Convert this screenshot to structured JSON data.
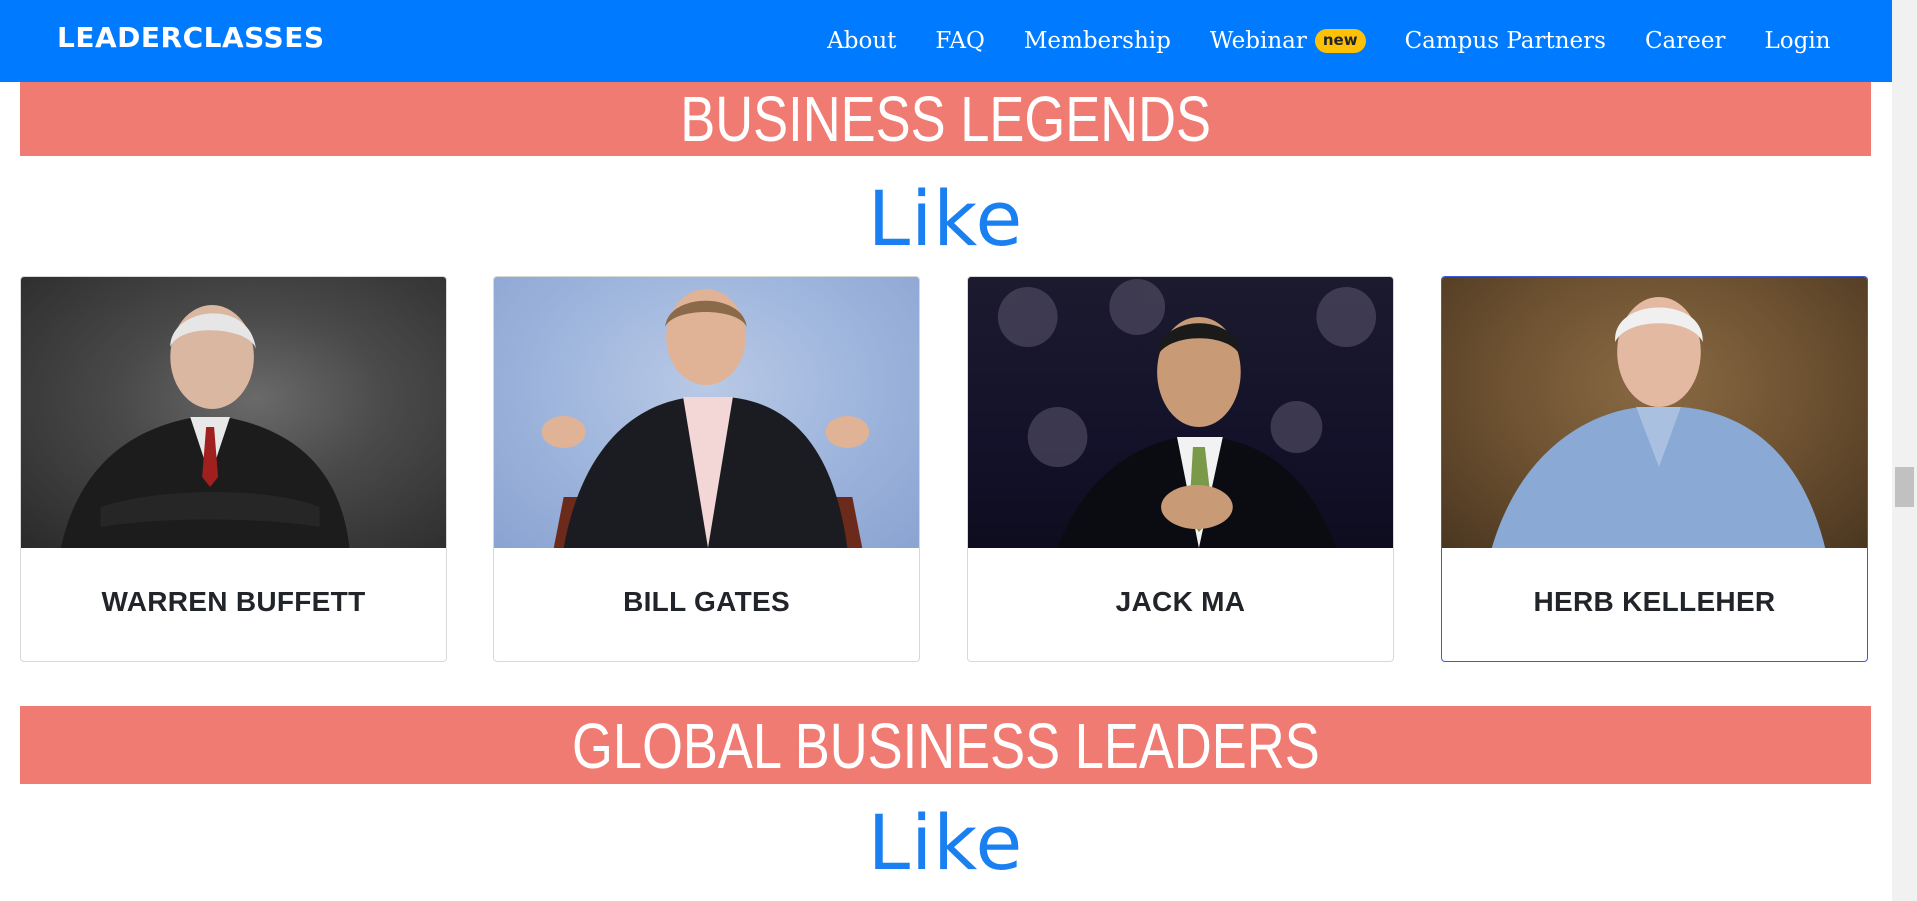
{
  "navbar": {
    "brand": "LEADERCLASSES",
    "items": [
      {
        "label": "About"
      },
      {
        "label": "FAQ"
      },
      {
        "label": "Membership"
      },
      {
        "label": "Webinar",
        "badge": "new"
      },
      {
        "label": "Campus Partners"
      },
      {
        "label": "Career"
      },
      {
        "label": "Login"
      }
    ],
    "colors": {
      "background": "#007bff",
      "badge": "#ffc107"
    }
  },
  "sections": [
    {
      "title": "BUSINESS LEGENDS",
      "subtitle": "Like",
      "cards": [
        {
          "name": "WARREN BUFFETT"
        },
        {
          "name": "BILL GATES"
        },
        {
          "name": "JACK MA"
        },
        {
          "name": "HERB KELLEHER"
        }
      ]
    },
    {
      "title": "GLOBAL BUSINESS LEADERS",
      "subtitle": "Like"
    }
  ],
  "colors": {
    "banner": "#f07b72",
    "like_text": "#1a7ff0"
  }
}
